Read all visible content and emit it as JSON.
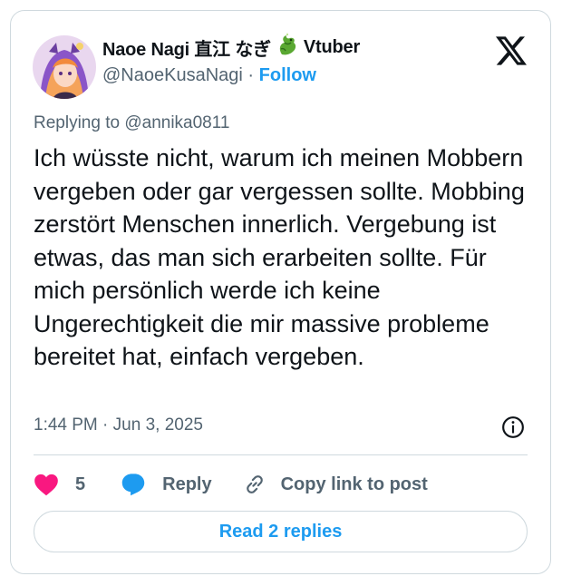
{
  "author": {
    "display_name": "Naoe Nagi 直江 なぎ",
    "name_suffix": "Vtuber",
    "handle": "@NaoeKusaNagi",
    "separator": "·",
    "follow_label": "Follow"
  },
  "icons": {
    "platform": "x-logo-icon",
    "name_emoji": "dragon-emoji-icon",
    "info": "info-icon",
    "like": "heart-icon",
    "reply": "speech-bubble-icon",
    "copy": "link-icon"
  },
  "tweet": {
    "replying_prefix": "Replying to",
    "replying_to": "@annika0811",
    "text": "Ich wüsste nicht, warum ich meinen Mobbern vergeben oder gar vergessen sollte. Mobbing zerstört Menschen innerlich. Vergebung ist etwas, das man sich erarbeiten sollte. Für mich persönlich werde ich keine Ungerechtigkeit die mir massive probleme bereitet hat, einfach vergeben.",
    "time": "1:44 PM",
    "meta_separator": "·",
    "date": "Jun 3, 2025"
  },
  "actions": {
    "like_count": "5",
    "reply_label": "Reply",
    "copy_label": "Copy link to post"
  },
  "read_replies_label": "Read 2 replies",
  "colors": {
    "accent": "#1d9bf0",
    "like": "#f91880",
    "text": "#0f1419",
    "muted": "#536471",
    "border": "#cfd9de"
  }
}
